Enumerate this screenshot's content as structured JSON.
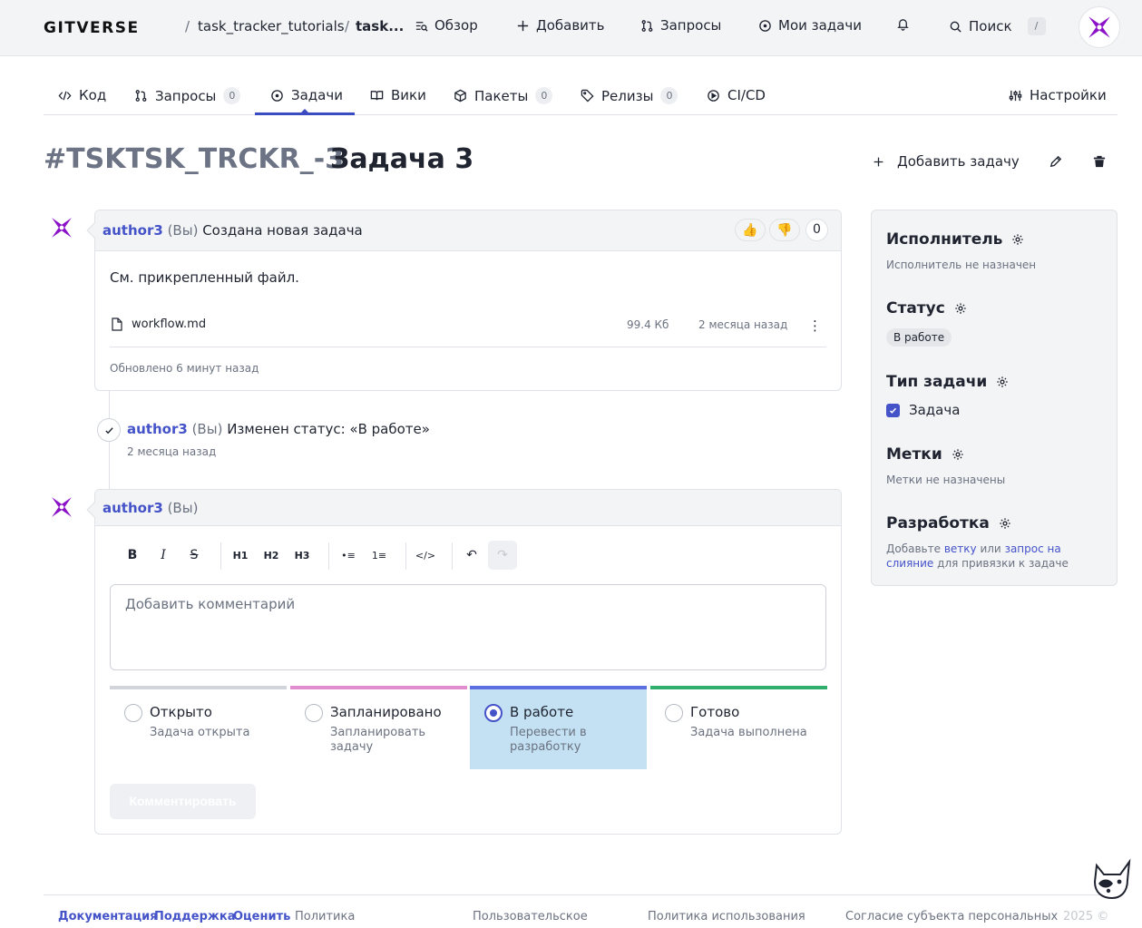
{
  "topbar": {
    "logo": "GITVERSE",
    "repo": "task_tracker_tutorials",
    "current": "task...",
    "separator": "/",
    "nav": [
      {
        "label": "Обзор",
        "icon": "overview-icon"
      },
      {
        "label": "Добавить",
        "icon": "plus-icon"
      },
      {
        "label": "Запросы",
        "icon": "pull-request-icon"
      },
      {
        "label": "Мои задачи",
        "icon": "issue-icon"
      }
    ],
    "search_label": "Поиск",
    "search_shortcut": "/"
  },
  "tabs": [
    {
      "label": "Код",
      "count": null
    },
    {
      "label": "Запросы",
      "count": "0"
    },
    {
      "label": "Задачи",
      "count": null,
      "active": true
    },
    {
      "label": "Вики",
      "count": null
    },
    {
      "label": "Пакеты",
      "count": "0"
    },
    {
      "label": "Релизы",
      "count": "0"
    },
    {
      "label": "CI/CD",
      "count": null
    }
  ],
  "settings_label": "Настройки",
  "issue": {
    "id": "#TSKTSK_TRCKR_-3",
    "title": "Задача 3",
    "add_task_label": "Добавить задачу"
  },
  "first_comment": {
    "author": "author3",
    "you": "(Вы)",
    "action": "Создана новая задача",
    "reactions": {
      "thumbs_up": "👍",
      "thumbs_down": "👎",
      "count": "0"
    },
    "body": "См. прикрепленный файл.",
    "file": {
      "name": "workflow.md",
      "size": "99.4 Кб",
      "date": "2 месяца назад",
      "more": "⋮"
    },
    "updated": "Обновлено 6 минут назад"
  },
  "status_event": {
    "author": "author3",
    "you": "(Вы)",
    "text": "Изменен статус: «В работе»",
    "time": "2 месяца назад"
  },
  "editor": {
    "author": "author3",
    "you": "(Вы)",
    "toolbar": [
      "B",
      "I",
      "S",
      "H1",
      "H2",
      "H3",
      "•≡",
      "1≡",
      "</>",
      "↶",
      "↷"
    ],
    "placeholder": "Добавить комментарий",
    "statuses": [
      {
        "label": "Открыто",
        "desc": "Задача открыта",
        "color": "#d1d5db",
        "selected": false
      },
      {
        "label": "Запланировано",
        "desc": "Запланировать задачу",
        "color": "#e08ccf",
        "selected": false
      },
      {
        "label": "В работе",
        "desc": "Перевести в разработку",
        "color": "#5b6fe0",
        "selected": true
      },
      {
        "label": "Готово",
        "desc": "Задача выполнена",
        "color": "#2fae6e",
        "selected": false
      }
    ],
    "submit_label": "Комментировать"
  },
  "sidebar": {
    "assignee_title": "Исполнитель",
    "assignee_value": "Исполнитель не назначен",
    "status_title": "Статус",
    "status_value": "В работе",
    "type_title": "Тип задачи",
    "type_value": "Задача",
    "labels_title": "Метки",
    "labels_value": "Метки не назначены",
    "dev_title": "Разработка",
    "dev_text_1": "Добавьте",
    "dev_link_1": "ветку",
    "dev_text_2": "или",
    "dev_link_2": "запрос на слияние",
    "dev_text_3": "для привязки к задаче"
  },
  "footer": {
    "links": [
      "Документация",
      "Поддержка",
      "Оценить"
    ],
    "policy": "Политика",
    "user_agreement": "Пользовательское",
    "usage_policy": "Политика использования",
    "consent": "Согласие субъекта персональных",
    "year": "2025 ©"
  },
  "colors": {
    "accent": "#4553c9",
    "brand_purple": "#8b12c7",
    "selected_status_bg": "#c3e1f3"
  }
}
